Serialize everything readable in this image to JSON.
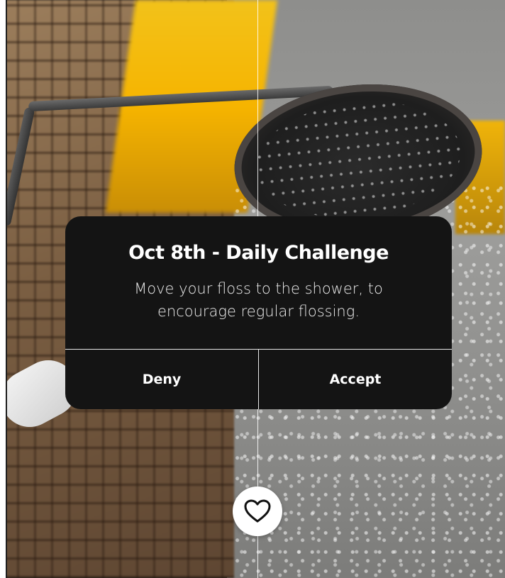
{
  "dialog": {
    "title": "Oct 8th - Daily Challenge",
    "message": "Move your floss to the shower, to encourage regular flossing.",
    "deny_label": "Deny",
    "accept_label": "Accept"
  },
  "favorite": {
    "icon": "heart-outline-icon"
  },
  "colors": {
    "dialog_background": "#141414",
    "text": "#ffffff",
    "divider": "#e8e8e8",
    "heart_button": "#ffffff"
  }
}
